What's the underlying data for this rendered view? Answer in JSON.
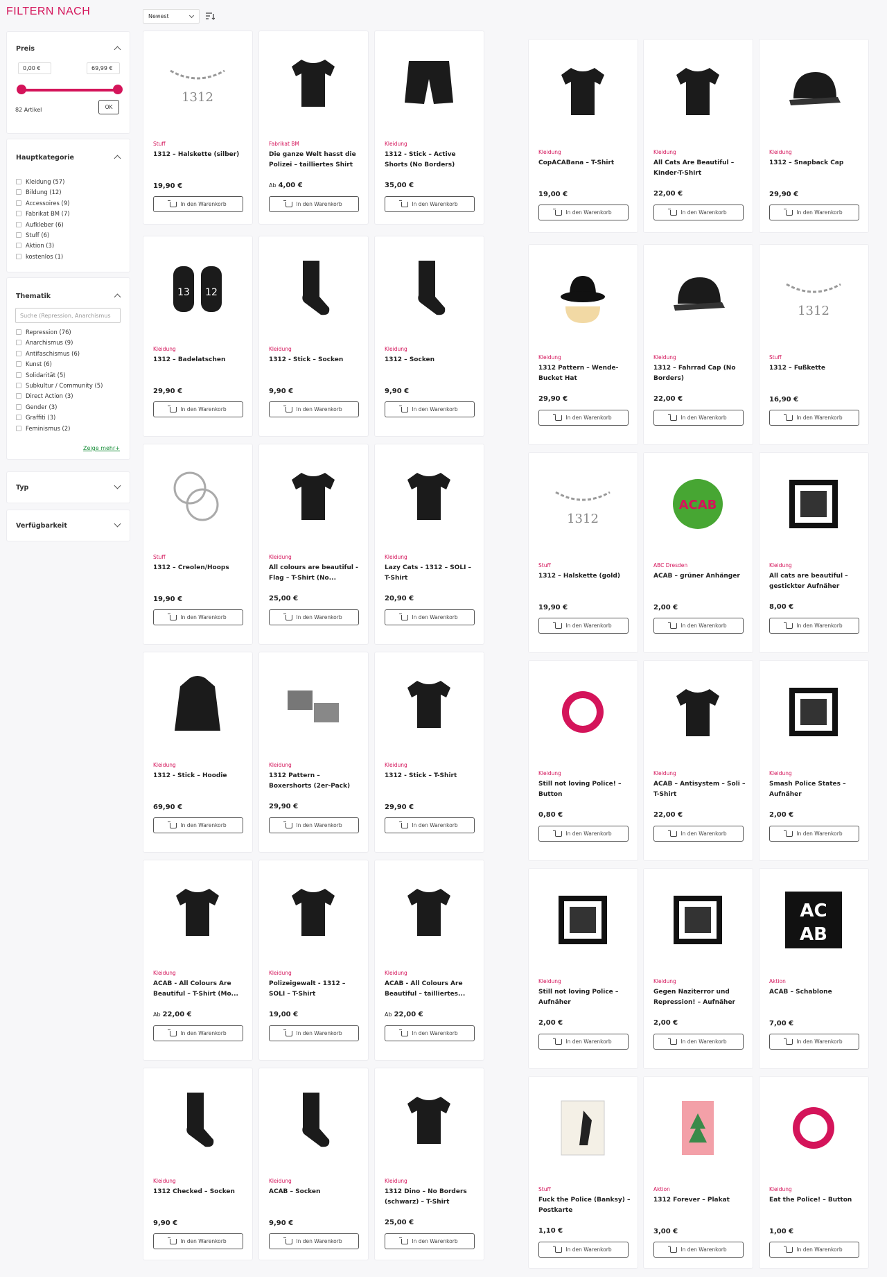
{
  "sidebar": {
    "title": "FILTERN NACH",
    "price": {
      "heading": "Preis",
      "min_value": "0,00 €",
      "max_value": "69,99 €",
      "range_low_fraction": 0,
      "range_high_fraction": 1,
      "count_text": "82 Artikel",
      "ok_label": "OK"
    },
    "category": {
      "heading": "Hauptkategorie",
      "items": [
        {
          "label": "Kleidung (57)"
        },
        {
          "label": "Bildung (12)"
        },
        {
          "label": "Accessoires (9)"
        },
        {
          "label": "Fabrikat BM (7)"
        },
        {
          "label": "Aufkleber (6)"
        },
        {
          "label": "Stuff (6)"
        },
        {
          "label": "Aktion (3)"
        },
        {
          "label": "kostenlos (1)"
        }
      ]
    },
    "topic": {
      "heading": "Thematik",
      "search_placeholder": "Suche (Repression, Anarchismus",
      "items": [
        {
          "label": "Repression (76)"
        },
        {
          "label": "Anarchismus (9)"
        },
        {
          "label": "Antifaschismus (6)"
        },
        {
          "label": "Kunst (6)"
        },
        {
          "label": "Solidarität (5)"
        },
        {
          "label": "Subkultur / Community (5)"
        },
        {
          "label": "Direct Action (3)"
        },
        {
          "label": "Gender (3)"
        },
        {
          "label": "Graffiti (3)"
        },
        {
          "label": "Feminismus (2)"
        }
      ],
      "more_label": "Zeige mehr+"
    },
    "type": {
      "heading": "Typ"
    },
    "availability": {
      "heading": "Verfügbarkeit"
    }
  },
  "toolbar": {
    "sort_value": "Newest",
    "sort_icon": "sort-icon"
  },
  "cart_label": "In den Warenkorb",
  "from_prefix": "Ab",
  "products": [
    {
      "cat": "Stuff",
      "name": "1312 – Halskette (silber)",
      "price": "19,90 €",
      "icon": "chain-icon"
    },
    {
      "cat": "Fabrikat BM",
      "name": "Die ganze Welt hasst die Polizei – tailliertes Shirt",
      "price": "4,00 €",
      "from": true,
      "icon": "tshirt-icon"
    },
    {
      "cat": "Kleidung",
      "name": "1312 - Stick – Active Shorts (No Borders)",
      "price": "35,00 €",
      "icon": "shorts-icon"
    },
    {
      "cat": "Kleidung",
      "name": "CopACABana – T-Shirt",
      "price": "19,00 €",
      "icon": "tshirt-icon"
    },
    {
      "cat": "Kleidung",
      "name": "All Cats Are Beautiful – Kinder-T-Shirt",
      "price": "22,00 €",
      "icon": "tshirt-icon"
    },
    {
      "cat": "Kleidung",
      "name": "1312 – Snapback Cap",
      "price": "29,90 €",
      "icon": "cap-icon"
    },
    {
      "cat": "Kleidung",
      "name": "1312 – Badelatschen",
      "price": "29,90 €",
      "icon": "slipper-icon"
    },
    {
      "cat": "Kleidung",
      "name": "1312 - Stick – Socken",
      "price": "9,90 €",
      "icon": "sock-icon"
    },
    {
      "cat": "Kleidung",
      "name": "1312 – Socken",
      "price": "9,90 €",
      "icon": "sock-icon"
    },
    {
      "cat": "Kleidung",
      "name": "1312 Pattern – Wende-Bucket Hat",
      "price": "29,90 €",
      "icon": "hat-icon"
    },
    {
      "cat": "Kleidung",
      "name": "1312 – Fahrrad Cap (No Borders)",
      "price": "22,00 €",
      "icon": "cap-icon"
    },
    {
      "cat": "Stuff",
      "name": "1312 – Fußkette",
      "price": "16,90 €",
      "icon": "chain-icon"
    },
    {
      "cat": "Stuff",
      "name": "1312 – Creolen/Hoops",
      "price": "19,90 €",
      "icon": "hoops-icon"
    },
    {
      "cat": "Kleidung",
      "name": "All colours are beautiful - Flag – T-Shirt (No...",
      "price": "25,00 €",
      "icon": "tshirt-icon"
    },
    {
      "cat": "Kleidung",
      "name": "Lazy Cats - 1312 – SOLI – T-Shirt",
      "price": "20,90 €",
      "icon": "tshirt-icon"
    },
    {
      "cat": "Stuff",
      "name": "1312 – Halskette (gold)",
      "price": "19,90 €",
      "icon": "chain-icon"
    },
    {
      "cat": "ABC Dresden",
      "name": "ACAB – grüner Anhänger",
      "price": "2,00 €",
      "icon": "pendant-icon"
    },
    {
      "cat": "Kleidung",
      "name": "All cats are beautiful – gestickter Aufnäher",
      "price": "8,00 €",
      "icon": "patch-icon"
    },
    {
      "cat": "Kleidung",
      "name": "1312 - Stick – Hoodie",
      "price": "69,90 €",
      "icon": "hoodie-icon"
    },
    {
      "cat": "Kleidung",
      "name": "1312 Pattern – Boxershorts (2er-Pack)",
      "price": "29,90 €",
      "icon": "boxer-icon"
    },
    {
      "cat": "Kleidung",
      "name": "1312 - Stick – T-Shirt",
      "price": "29,90 €",
      "icon": "tshirt-icon"
    },
    {
      "cat": "Kleidung",
      "name": "Still not loving Police! – Button",
      "price": "0,80 €",
      "icon": "button-icon"
    },
    {
      "cat": "Kleidung",
      "name": "ACAB – Antisystem – Soli – T-Shirt",
      "price": "22,00 €",
      "icon": "tshirt-icon"
    },
    {
      "cat": "Kleidung",
      "name": "Smash Police States – Aufnäher",
      "price": "2,00 €",
      "icon": "patch-icon"
    },
    {
      "cat": "Kleidung",
      "name": "ACAB - All Colours Are Beautiful – T-Shirt (Mo...",
      "price": "22,00 €",
      "from": true,
      "icon": "tshirt-icon"
    },
    {
      "cat": "Kleidung",
      "name": "Polizeigewalt - 1312 – SOLI – T-Shirt",
      "price": "19,00 €",
      "icon": "tshirt-icon"
    },
    {
      "cat": "Kleidung",
      "name": "ACAB - All Colours Are Beautiful – tailliertes...",
      "price": "22,00 €",
      "from": true,
      "icon": "tshirt-icon"
    },
    {
      "cat": "Kleidung",
      "name": "Still not loving Police – Aufnäher",
      "price": "2,00 €",
      "icon": "patch-icon"
    },
    {
      "cat": "Kleidung",
      "name": "Gegen Naziterror und Repression! – Aufnäher",
      "price": "2,00 €",
      "icon": "patch-icon"
    },
    {
      "cat": "Aktion",
      "name": "ACAB – Schablone",
      "price": "7,00 €",
      "icon": "stencil-icon"
    },
    {
      "cat": "Kleidung",
      "name": "1312 Checked – Socken",
      "price": "9,90 €",
      "icon": "sock-icon"
    },
    {
      "cat": "Kleidung",
      "name": "ACAB – Socken",
      "price": "9,90 €",
      "icon": "sock-icon"
    },
    {
      "cat": "Kleidung",
      "name": "1312 Dino – No Borders (schwarz) – T-Shirt",
      "price": "25,00 €",
      "icon": "tshirt-icon"
    },
    {
      "cat": "Stuff",
      "name": "Fuck the Police (Banksy) – Postkarte",
      "price": "1,10 €",
      "icon": "postcard-icon"
    },
    {
      "cat": "Aktion",
      "name": "1312 Forever – Plakat",
      "price": "3,00 €",
      "icon": "poster-icon"
    },
    {
      "cat": "Kleidung",
      "name": "Eat the Police! – Button",
      "price": "1,00 €",
      "icon": "button-icon"
    }
  ]
}
